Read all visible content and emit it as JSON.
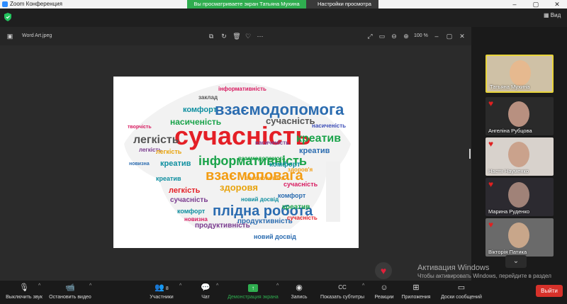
{
  "window": {
    "title": "Zoom Конференция",
    "minimize": "–",
    "maximize": "▢",
    "close": "✕"
  },
  "share_banner": "Вы просматриваете экран Татьяна Мухина",
  "view_settings": "Настройки просмотра",
  "topbar": {
    "view_label": "Вид"
  },
  "viewer": {
    "filename": "Word Art.jpeg",
    "zoom": "100 %"
  },
  "word_cloud": {
    "words": [
      "інформативність",
      "заклад",
      "комфорт",
      "взаємодопомога",
      "насиченість",
      "сучасність",
      "сучасність",
      "легкість",
      "креатив",
      "креатив",
      "інформативність",
      "взаємоповага",
      "здоровя",
      "креатив",
      "легкість",
      "сучасність",
      "комфорт",
      "плідна робота",
      "креатив",
      "продуктивність",
      "продуктивність",
      "новий досвід",
      "комфорт",
      "легкість",
      "творчість",
      "насиченість",
      "новизна",
      "здоров'я",
      "сучасність",
      "комфорт",
      "креатив",
      "насиченість",
      "новий досвід",
      "легкість",
      "сучасність",
      "взаємодопомога",
      "новизна",
      "взаємоповага"
    ],
    "colors": [
      "#e41f26",
      "#2b6cb0",
      "#1aa34a",
      "#f39c12",
      "#7a3b8f",
      "#d81b60",
      "#0f8fa0",
      "#3d4eb8",
      "#e8a30c",
      "#555555"
    ]
  },
  "participants": [
    {
      "name": "Татьяна Мухина",
      "bg": "#cfc1a6",
      "face": "#e6b98f"
    },
    {
      "name": "Ангеліна Рубцова",
      "bg": "#2a2a2a",
      "face": "#b89080"
    },
    {
      "name": "Настя Науменко",
      "bg": "#d8d2cc",
      "face": "#caa28c"
    },
    {
      "name": "Марина Руденко",
      "bg": "#2c2a30",
      "face": "#a08278"
    },
    {
      "name": "Вікторія Патика",
      "bg": "#6a6a6a",
      "face": "#c8a68a"
    }
  ],
  "watermark": {
    "title": "Активация Windows",
    "subtitle": "Чтобы активировать Windows, перейдите в раздел \"Параметры\"."
  },
  "toolbar": {
    "mute": "Выключить звук",
    "video": "Остановить видео",
    "participants": "Участники",
    "participants_count": "8",
    "chat": "Чат",
    "share": "Демонстрация экрана",
    "record": "Запись",
    "captions": "Показать субтитры",
    "reactions": "Реакции",
    "apps": "Приложения",
    "whiteboards": "Доски сообщений",
    "leave": "Выйти"
  }
}
